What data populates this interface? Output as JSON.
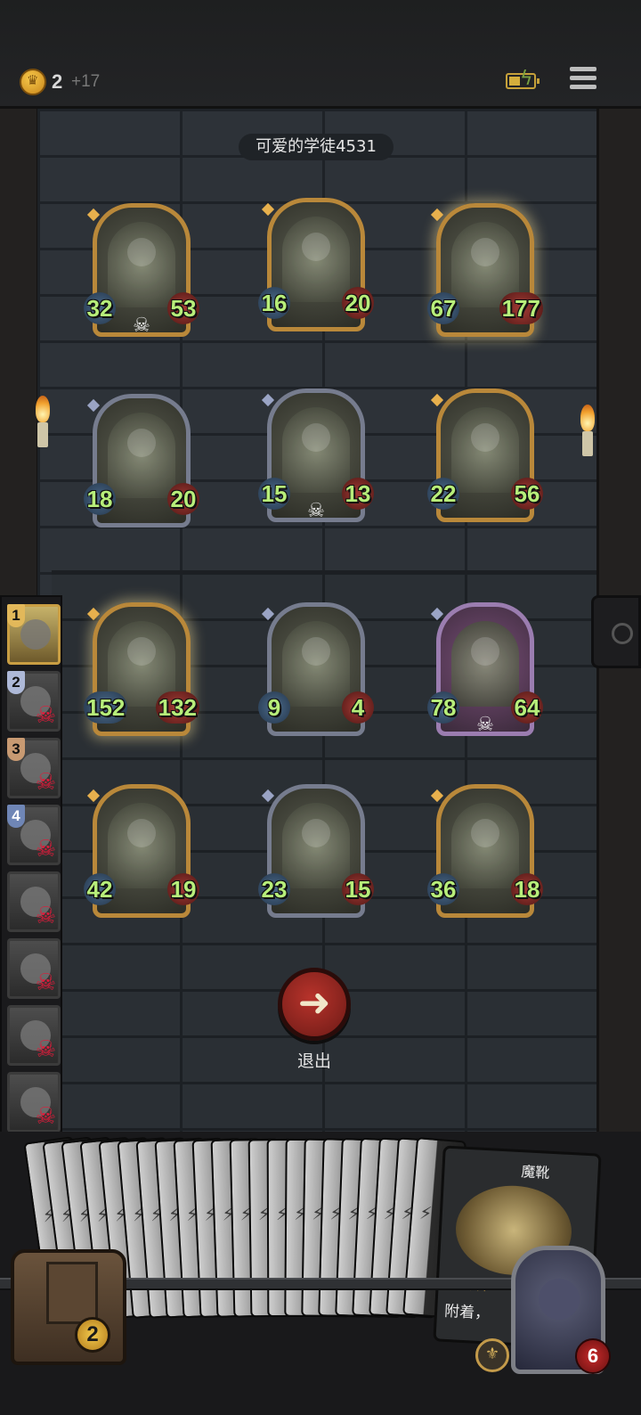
{
  "topbar": {
    "gold": "2",
    "gold_income": "+17",
    "icons": [
      "coin-icon",
      "battery-icon",
      "menu-icon"
    ]
  },
  "opponent": {
    "name": "可爱的学徒4531"
  },
  "enemy_board": [
    {
      "atk": "32",
      "hp": "53",
      "tier": "gold",
      "skull": true,
      "glow": false
    },
    {
      "atk": "16",
      "hp": "20",
      "tier": "gold",
      "skull": false,
      "glow": false
    },
    {
      "atk": "67",
      "hp": "177",
      "tier": "gold",
      "skull": false,
      "glow": true
    },
    {
      "atk": "18",
      "hp": "20",
      "tier": "silver",
      "skull": false,
      "glow": false
    },
    {
      "atk": "15",
      "hp": "13",
      "tier": "silver",
      "skull": true,
      "glow": false
    },
    {
      "atk": "22",
      "hp": "56",
      "tier": "gold",
      "skull": false,
      "glow": false
    }
  ],
  "player_board": [
    {
      "atk": "152",
      "hp": "132",
      "tier": "gold",
      "skull": false,
      "glow": true
    },
    {
      "atk": "9",
      "hp": "4",
      "tier": "silver",
      "skull": false,
      "glow": false
    },
    {
      "atk": "78",
      "hp": "64",
      "tier": "pink",
      "skull": true,
      "glow": false
    },
    {
      "atk": "42",
      "hp": "19",
      "tier": "gold",
      "skull": false,
      "glow": false
    },
    {
      "atk": "23",
      "hp": "15",
      "tier": "silver",
      "skull": false,
      "glow": false
    },
    {
      "atk": "36",
      "hp": "18",
      "tier": "gold",
      "skull": false,
      "glow": false
    }
  ],
  "history": [
    {
      "rank": "1",
      "dead": false
    },
    {
      "rank": "2",
      "dead": true
    },
    {
      "rank": "3",
      "dead": true
    },
    {
      "rank": "4",
      "dead": true
    },
    {
      "rank": "",
      "dead": true
    },
    {
      "rank": "",
      "dead": true
    },
    {
      "rank": "",
      "dead": true
    },
    {
      "rank": "",
      "dead": true
    }
  ],
  "exit": {
    "label": "退出"
  },
  "featured_card": {
    "name": "魔靴",
    "text": "附着，",
    "stars": "★★"
  },
  "chest": {
    "count": "2"
  },
  "hero": {
    "hp": "6"
  },
  "colors": {
    "attack_text": "#b7ee7a",
    "exit_red": "#b8332b",
    "gold_frame": "#b9883a"
  }
}
